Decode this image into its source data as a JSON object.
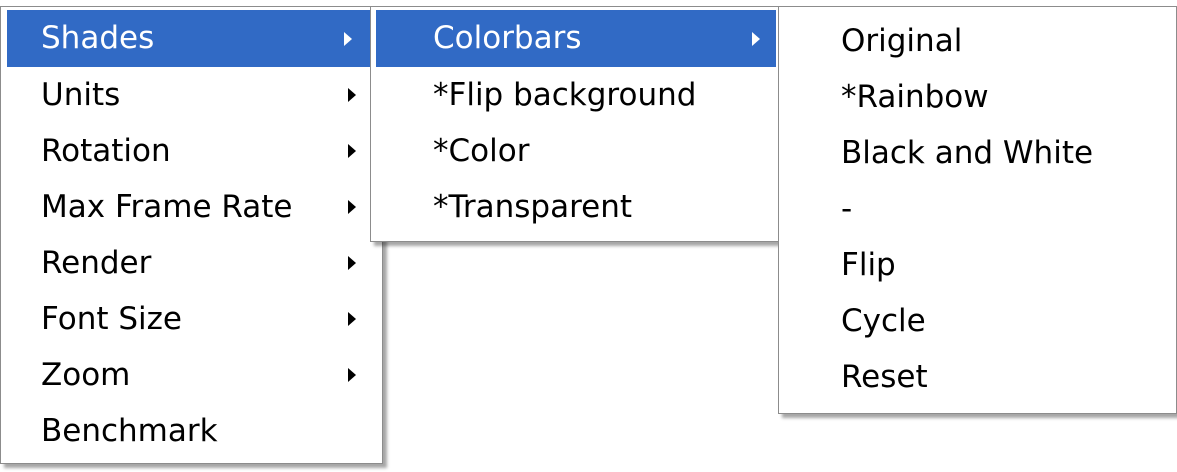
{
  "main_menu": {
    "items": [
      {
        "label": "Shades",
        "submenu": true,
        "highlighted": true
      },
      {
        "label": "Units",
        "submenu": true
      },
      {
        "label": "Rotation",
        "submenu": true
      },
      {
        "label": "Max Frame Rate",
        "submenu": true
      },
      {
        "label": "Render",
        "submenu": true
      },
      {
        "label": "Font Size",
        "submenu": true
      },
      {
        "label": "Zoom",
        "submenu": true
      },
      {
        "label": "Benchmark",
        "submenu": false
      }
    ]
  },
  "shades_menu": {
    "items": [
      {
        "label": "Colorbars",
        "submenu": true,
        "highlighted": true
      },
      {
        "label": "*Flip background"
      },
      {
        "label": "*Color"
      },
      {
        "label": "*Transparent"
      }
    ]
  },
  "colorbars_menu": {
    "items": [
      {
        "label": "Original"
      },
      {
        "label": "*Rainbow"
      },
      {
        "label": "Black and White"
      },
      {
        "label": "-"
      },
      {
        "label": "Flip"
      },
      {
        "label": "Cycle"
      },
      {
        "label": "Reset"
      }
    ]
  },
  "colors": {
    "highlight": "#316ac5",
    "menu_background": "#ffffff",
    "menu_border": "#8c8c8c"
  }
}
